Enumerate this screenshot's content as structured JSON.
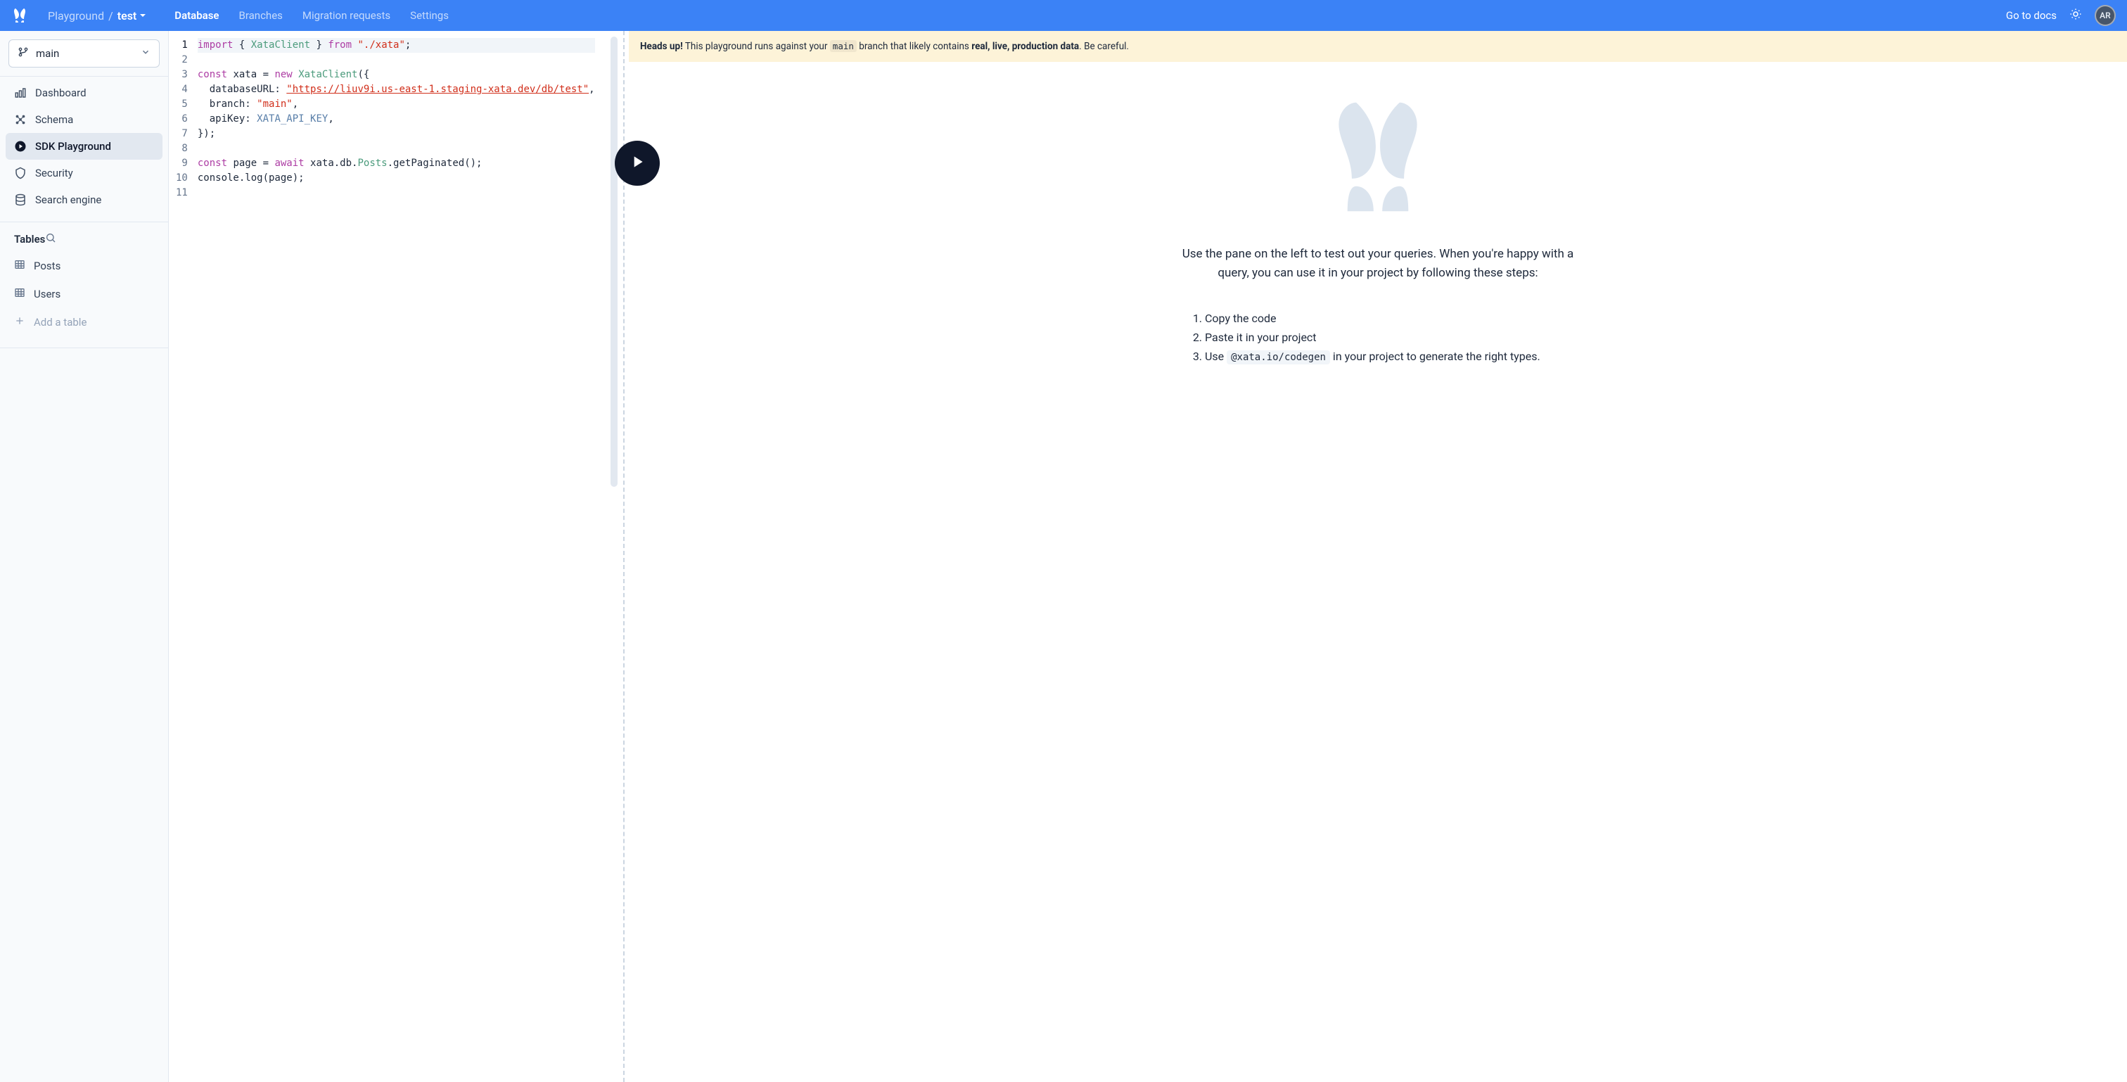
{
  "colors": {
    "primary": "#3b82f6",
    "sidebarBg": "#f8fafc",
    "warningBg": "#fdf3d8"
  },
  "topbar": {
    "breadcrumb_parent": "Playground",
    "breadcrumb_current": "test",
    "nav": [
      {
        "label": "Database",
        "active": true
      },
      {
        "label": "Branches",
        "active": false
      },
      {
        "label": "Migration requests",
        "active": false
      },
      {
        "label": "Settings",
        "active": false
      }
    ],
    "docs_label": "Go to docs",
    "avatar_initials": "AR"
  },
  "sidebar": {
    "branch_selected": "main",
    "nav": [
      {
        "label": "Dashboard",
        "icon": "chart-bar-icon",
        "active": false
      },
      {
        "label": "Schema",
        "icon": "schema-icon",
        "active": false
      },
      {
        "label": "SDK Playground",
        "icon": "play-circle-icon",
        "active": true
      },
      {
        "label": "Security",
        "icon": "shield-icon",
        "active": false
      },
      {
        "label": "Search engine",
        "icon": "database-icon",
        "active": false
      }
    ],
    "tables_heading": "Tables",
    "tables": [
      {
        "name": "Posts"
      },
      {
        "name": "Users"
      }
    ],
    "add_table_label": "Add a table"
  },
  "editor": {
    "line_count": 11,
    "highlighted_line": 1,
    "tokens": [
      [
        {
          "t": "kw",
          "v": "import"
        },
        {
          "t": "plain",
          "v": " { "
        },
        {
          "t": "type",
          "v": "XataClient"
        },
        {
          "t": "plain",
          "v": " } "
        },
        {
          "t": "kw",
          "v": "from"
        },
        {
          "t": "plain",
          "v": " "
        },
        {
          "t": "str",
          "v": "\"./xata\""
        },
        {
          "t": "plain",
          "v": ";"
        }
      ],
      [],
      [
        {
          "t": "kw",
          "v": "const"
        },
        {
          "t": "plain",
          "v": " xata = "
        },
        {
          "t": "kw",
          "v": "new"
        },
        {
          "t": "plain",
          "v": " "
        },
        {
          "t": "type",
          "v": "XataClient"
        },
        {
          "t": "plain",
          "v": "({"
        }
      ],
      [
        {
          "t": "plain",
          "v": "  databaseURL: "
        },
        {
          "t": "link",
          "v": "\"https://liuv9i.us-east-1.staging-xata.dev/db/test\""
        },
        {
          "t": "plain",
          "v": ","
        }
      ],
      [
        {
          "t": "plain",
          "v": "  branch: "
        },
        {
          "t": "str",
          "v": "\"main\""
        },
        {
          "t": "plain",
          "v": ","
        }
      ],
      [
        {
          "t": "plain",
          "v": "  apiKey: "
        },
        {
          "t": "ident",
          "v": "XATA_API_KEY"
        },
        {
          "t": "plain",
          "v": ","
        }
      ],
      [
        {
          "t": "plain",
          "v": "});"
        }
      ],
      [],
      [
        {
          "t": "kw",
          "v": "const"
        },
        {
          "t": "plain",
          "v": " page = "
        },
        {
          "t": "kw",
          "v": "await"
        },
        {
          "t": "plain",
          "v": " xata.db."
        },
        {
          "t": "type",
          "v": "Posts"
        },
        {
          "t": "plain",
          "v": ".getPaginated();"
        }
      ],
      [
        {
          "t": "plain",
          "v": "console.log(page);"
        }
      ],
      []
    ]
  },
  "warning": {
    "heads_up": "Heads up!",
    "text_before": " This playground runs against your ",
    "branch_code": "main",
    "text_mid": " branch that likely contains ",
    "bold_data": "real, live, production data",
    "text_after": ". Be careful."
  },
  "results": {
    "intro": "Use the pane on the left to test out your queries. When you're happy with a query, you can use it in your project by following these steps:",
    "steps": [
      {
        "text_before": "Copy the code",
        "code": "",
        "text_after": ""
      },
      {
        "text_before": "Paste it in your project",
        "code": "",
        "text_after": ""
      },
      {
        "text_before": "Use ",
        "code": "@xata.io/codegen",
        "text_after": " in your project to generate the right types."
      }
    ]
  }
}
